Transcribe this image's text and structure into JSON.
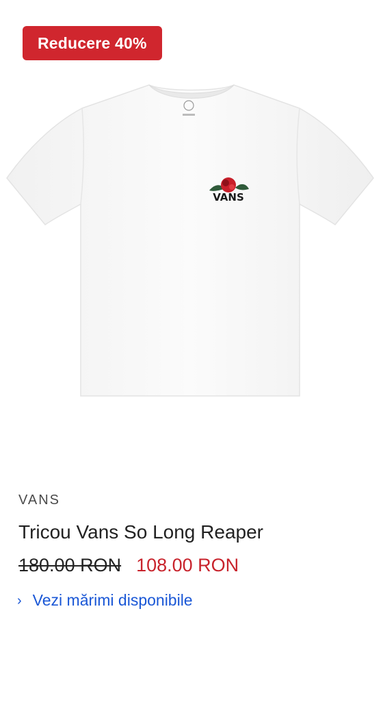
{
  "badge": {
    "label": "Reducere 40%"
  },
  "product": {
    "brand": "VANS",
    "name": "Tricou Vans So Long Reaper",
    "old_price": "180.00 RON",
    "new_price": "108.00 RON",
    "sizes_link": "Vezi mărimi disponibile",
    "image_logo_text": "VANS",
    "image_alt": "white t-shirt with small rose and VANS logo on chest"
  },
  "icons": {
    "link_chevron": "›"
  },
  "colors": {
    "badge_bg": "#d0262e",
    "sale_price": "#c8232c",
    "link": "#1a57d6"
  }
}
